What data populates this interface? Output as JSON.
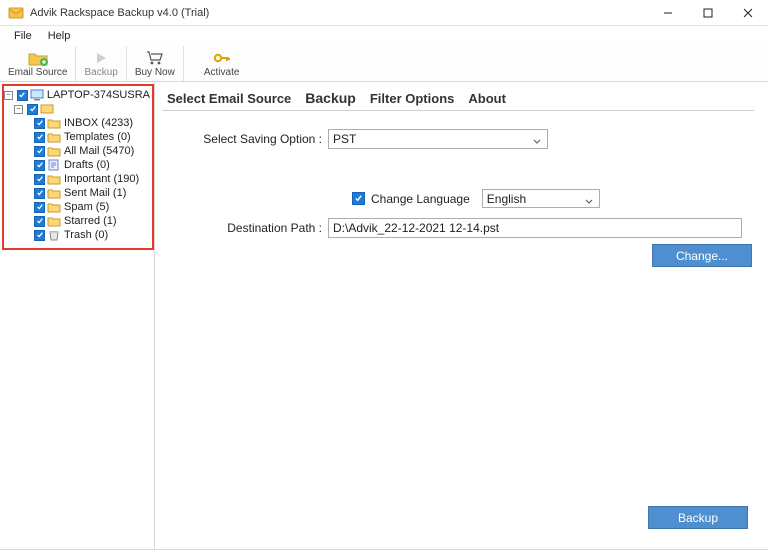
{
  "window": {
    "title": "Advik Rackspace Backup v4.0 (Trial)"
  },
  "menubar": {
    "file": "File",
    "help": "Help"
  },
  "toolbar": {
    "email_source": "Email Source",
    "backup": "Backup",
    "buy_now": "Buy Now",
    "activate": "Activate"
  },
  "tree": {
    "root": "LAPTOP-374SUSRA",
    "items": [
      {
        "label": "INBOX (4233)"
      },
      {
        "label": "Templates (0)"
      },
      {
        "label": "All Mail (5470)"
      },
      {
        "label": "Drafts (0)"
      },
      {
        "label": "Important (190)"
      },
      {
        "label": "Sent Mail (1)"
      },
      {
        "label": "Spam (5)"
      },
      {
        "label": "Starred (1)"
      },
      {
        "label": "Trash (0)"
      }
    ]
  },
  "tabs": {
    "select_source": "Select Email Source",
    "backup": "Backup",
    "filter": "Filter Options",
    "about": "About"
  },
  "form": {
    "saving_option_label": "Select Saving Option  :",
    "saving_option_value": "PST",
    "change_language_label": "Change Language",
    "language_value": "English",
    "destination_label": "Destination Path  :",
    "destination_value": "D:\\Advik_22-12-2021 12-14.pst",
    "change_button": "Change...",
    "backup_button": "Backup"
  }
}
